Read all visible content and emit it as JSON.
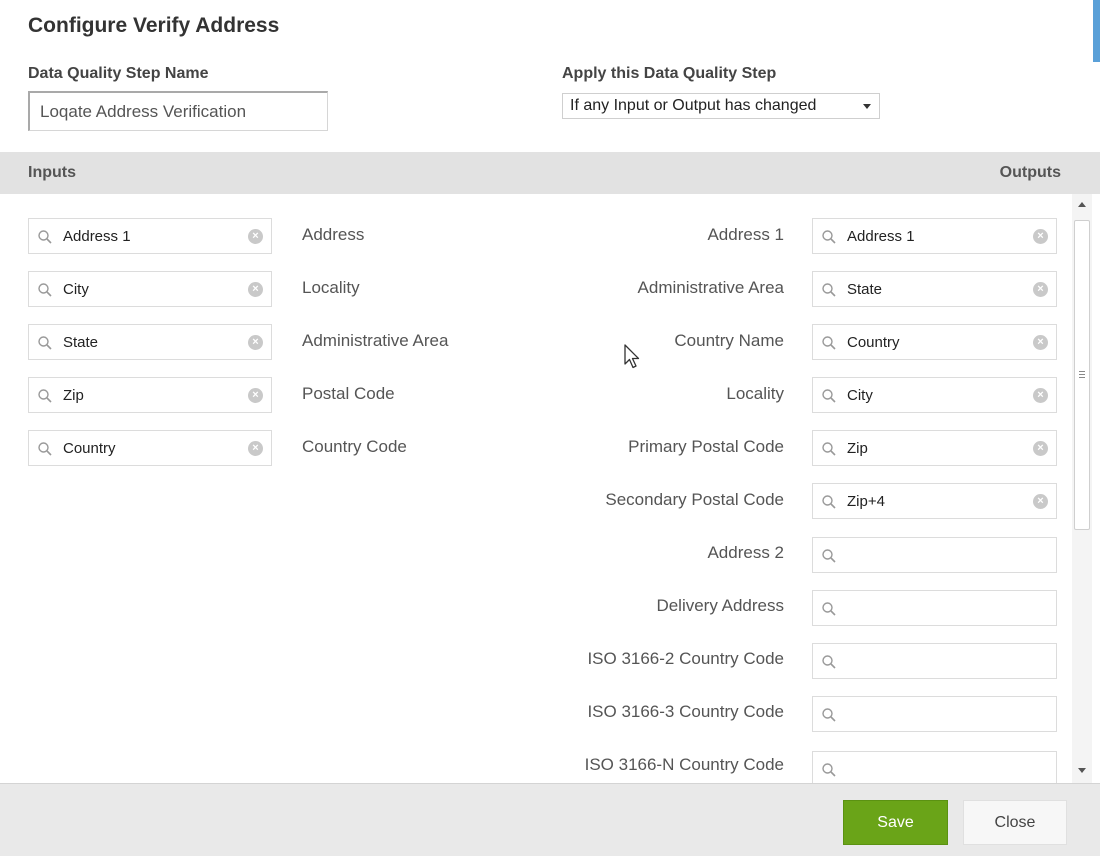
{
  "dialog": {
    "title": "Configure Verify Address"
  },
  "step_name": {
    "label": "Data Quality Step Name",
    "value": "Loqate Address Verification"
  },
  "apply": {
    "label": "Apply this Data Quality Step",
    "selected": "If any Input or Output has changed"
  },
  "section": {
    "inputs_label": "Inputs",
    "outputs_label": "Outputs"
  },
  "inputs": [
    {
      "field": "Address 1",
      "name": "Address"
    },
    {
      "field": "City",
      "name": "Locality"
    },
    {
      "field": "State",
      "name": "Administrative Area"
    },
    {
      "field": "Zip",
      "name": "Postal Code"
    },
    {
      "field": "Country",
      "name": "Country Code"
    }
  ],
  "outputs": [
    {
      "name": "Address 1",
      "field": "Address 1"
    },
    {
      "name": "Administrative Area",
      "field": "State"
    },
    {
      "name": "Country Name",
      "field": "Country"
    },
    {
      "name": "Locality",
      "field": "City"
    },
    {
      "name": "Primary Postal Code",
      "field": "Zip"
    },
    {
      "name": "Secondary Postal Code",
      "field": "Zip+4"
    },
    {
      "name": "Address 2",
      "field": ""
    },
    {
      "name": "Delivery Address",
      "field": ""
    },
    {
      "name": "ISO 3166-2 Country Code",
      "field": ""
    },
    {
      "name": "ISO 3166-3 Country Code",
      "field": ""
    },
    {
      "name": "ISO 3166-N Country Code",
      "field": ""
    }
  ],
  "footer": {
    "save_label": "Save",
    "close_label": "Close"
  },
  "colors": {
    "save_button": "#6aa418",
    "section_bar": "#e2e2e2",
    "footer": "#e9e9e9"
  },
  "icons": {
    "search": "search-icon",
    "clear": "clear-icon",
    "dropdown": "chevron-down-icon"
  }
}
